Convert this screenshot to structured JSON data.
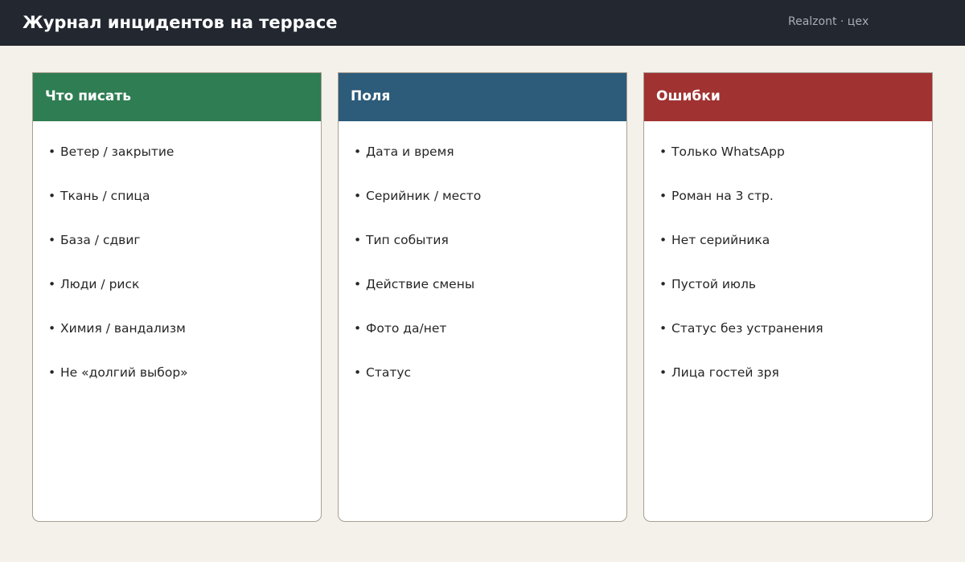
{
  "header": {
    "title": "Журнал инцидентов на террасе",
    "subtitle": "Realzont · цех"
  },
  "colors": {
    "topbar": "#222730",
    "background": "#f4f1ea",
    "card_green": "#2f7d53",
    "card_blue": "#2d5b7a",
    "card_red": "#a03232"
  },
  "cards": [
    {
      "title": "Что писать",
      "color": "#2f7d53",
      "items": [
        "Ветер / закрытие",
        "Ткань / спица",
        "База / сдвиг",
        "Люди / риск",
        "Химия / вандализм",
        "Не «долгий выбор»"
      ]
    },
    {
      "title": "Поля",
      "color": "#2d5b7a",
      "items": [
        "Дата и время",
        "Серийник / место",
        "Тип события",
        "Действие смены",
        "Фото да/нет",
        "Статус"
      ]
    },
    {
      "title": "Ошибки",
      "color": "#a03232",
      "items": [
        "Только WhatsApp",
        "Роман на 3 стр.",
        "Нет серийника",
        "Пустой июль",
        "Статус без устранения",
        "Лица гостей зря"
      ]
    }
  ]
}
